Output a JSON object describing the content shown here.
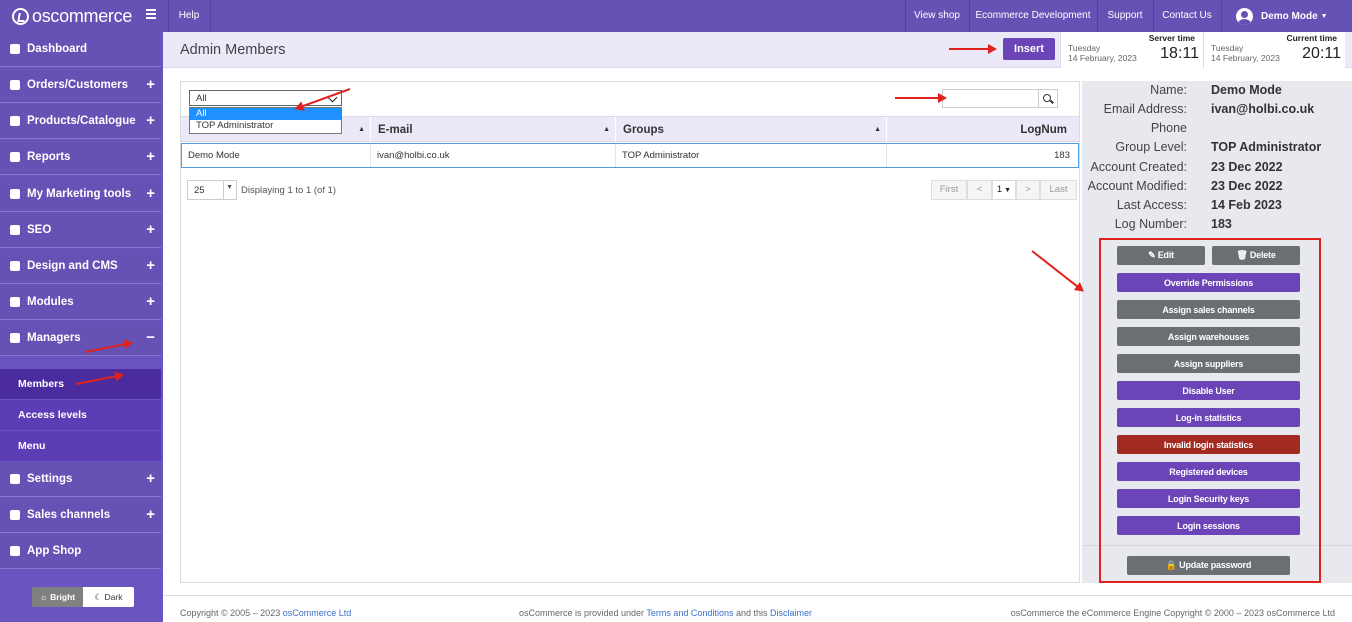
{
  "app": {
    "logo": "oscommerce"
  },
  "topbar": {
    "help": "Help",
    "links": [
      "View shop",
      "Ecommerce Development",
      "Support",
      "Contact Us"
    ],
    "user": "Demo Mode"
  },
  "sidebar": {
    "items": [
      {
        "label": "Dashboard",
        "icon": "dashboard-icon",
        "expander": ""
      },
      {
        "label": "Orders/Customers",
        "icon": "users-icon",
        "expander": "+"
      },
      {
        "label": "Products/Catalogue",
        "icon": "folder-icon",
        "expander": "+"
      },
      {
        "label": "Reports",
        "icon": "chart-icon",
        "expander": "+"
      },
      {
        "label": "My Marketing tools",
        "icon": "tag-icon",
        "expander": "+"
      },
      {
        "label": "SEO",
        "icon": "sitemap-icon",
        "expander": "+"
      },
      {
        "label": "Design and CMS",
        "icon": "brush-icon",
        "expander": "+"
      },
      {
        "label": "Modules",
        "icon": "puzzle-icon",
        "expander": "+"
      },
      {
        "label": "Managers",
        "icon": "user-icon",
        "expander": "−"
      }
    ],
    "subitems": [
      "Members",
      "Access levels",
      "Menu"
    ],
    "items_after": [
      {
        "label": "Settings",
        "icon": "gears-icon",
        "expander": "+"
      },
      {
        "label": "Sales channels",
        "icon": "monitor-icon",
        "expander": "+"
      },
      {
        "label": "App Shop",
        "icon": "cart-icon",
        "expander": ""
      }
    ],
    "theme": {
      "bright": "Bright",
      "dark": "Dark"
    }
  },
  "header": {
    "title": "Admin Members",
    "insert": "Insert",
    "server_time": {
      "label": "Server time",
      "day": "Tuesday",
      "date": "14 February, 2023",
      "time": "18:11"
    },
    "current_time": {
      "label": "Current time",
      "day": "Tuesday",
      "date": "14 February, 2023",
      "time": "20:11"
    }
  },
  "filter": {
    "selected": "All",
    "options": [
      "All",
      "TOP Administrator"
    ]
  },
  "table": {
    "columns": [
      "E-mail",
      "Groups",
      "LogNum"
    ],
    "rows": [
      {
        "name": "Demo Mode",
        "email": "ivan@holbi.co.uk",
        "group": "TOP Administrator",
        "lognum": "183"
      }
    ]
  },
  "pager": {
    "page_size": "25",
    "info": "Displaying 1 to 1 (of 1)",
    "first": "First",
    "page": "1",
    "last": "Last"
  },
  "details": {
    "name_label": "Name:",
    "name": "Demo Mode",
    "email_label": "Email Address:",
    "email": "ivan@holbi.co.uk",
    "phone_label": "Phone",
    "group_label": "Group Level:",
    "group": "TOP Administrator",
    "created_label": "Account Created:",
    "created": "23 Dec 2022",
    "modified_label": "Account Modified:",
    "modified": "23 Dec 2022",
    "access_label": "Last Access:",
    "access": "14 Feb 2023",
    "lognum_label": "Log Number:",
    "lognum": "183"
  },
  "actions": {
    "edit": "Edit",
    "delete": "Delete",
    "buttons": [
      {
        "label": "Override Permissions",
        "style": "purple"
      },
      {
        "label": "Assign sales channels",
        "style": "gray"
      },
      {
        "label": "Assign warehouses",
        "style": "gray"
      },
      {
        "label": "Assign suppliers",
        "style": "gray"
      },
      {
        "label": "Disable User",
        "style": "purple"
      },
      {
        "label": "Log-in statistics",
        "style": "purple"
      },
      {
        "label": "Invalid login statistics",
        "style": "red"
      },
      {
        "label": "Registered devices",
        "style": "purple"
      },
      {
        "label": "Login Security keys",
        "style": "purple"
      },
      {
        "label": "Login sessions",
        "style": "purple"
      }
    ],
    "update_password": "Update password"
  },
  "footer": {
    "copyright": "Copyright © 2005 – 2023",
    "copyright_link": "osCommerce Ltd",
    "center_pre": "osCommerce is provided under",
    "terms": "Terms and Conditions",
    "center_mid": "and this",
    "disclaimer": "Disclaimer",
    "right": "osCommerce the eCommerce Engine Copyright © 2000 – 2023 osCommerce Ltd"
  },
  "colors": {
    "brand": "#6652b4",
    "accent": "#6b44b8",
    "danger": "#a32a21",
    "annotation": "#e0221f"
  }
}
